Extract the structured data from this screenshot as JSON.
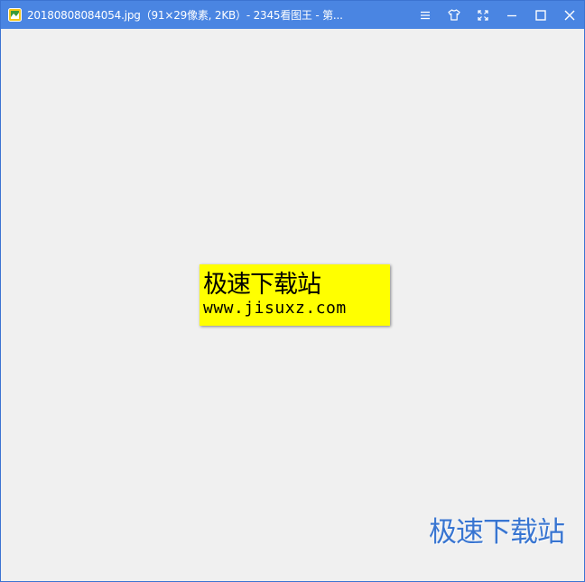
{
  "window": {
    "title": "20180808084054.jpg（91×29像素, 2KB）- 2345看图王 - 第...",
    "accent_color": "#4a85e2"
  },
  "title_bar": {
    "app_icon": "image-viewer-app-icon",
    "controls": [
      {
        "icon": "menu-icon"
      },
      {
        "icon": "skin-icon"
      },
      {
        "icon": "fullscreen-icon"
      },
      {
        "icon": "minimize-icon"
      },
      {
        "icon": "maximize-icon"
      },
      {
        "icon": "close-icon"
      }
    ]
  },
  "displayed_image": {
    "background_color": "#ffff00",
    "line1": "极速下载站",
    "line2": "www.jisuxz.com"
  },
  "watermark": {
    "text": "极速下载站"
  }
}
